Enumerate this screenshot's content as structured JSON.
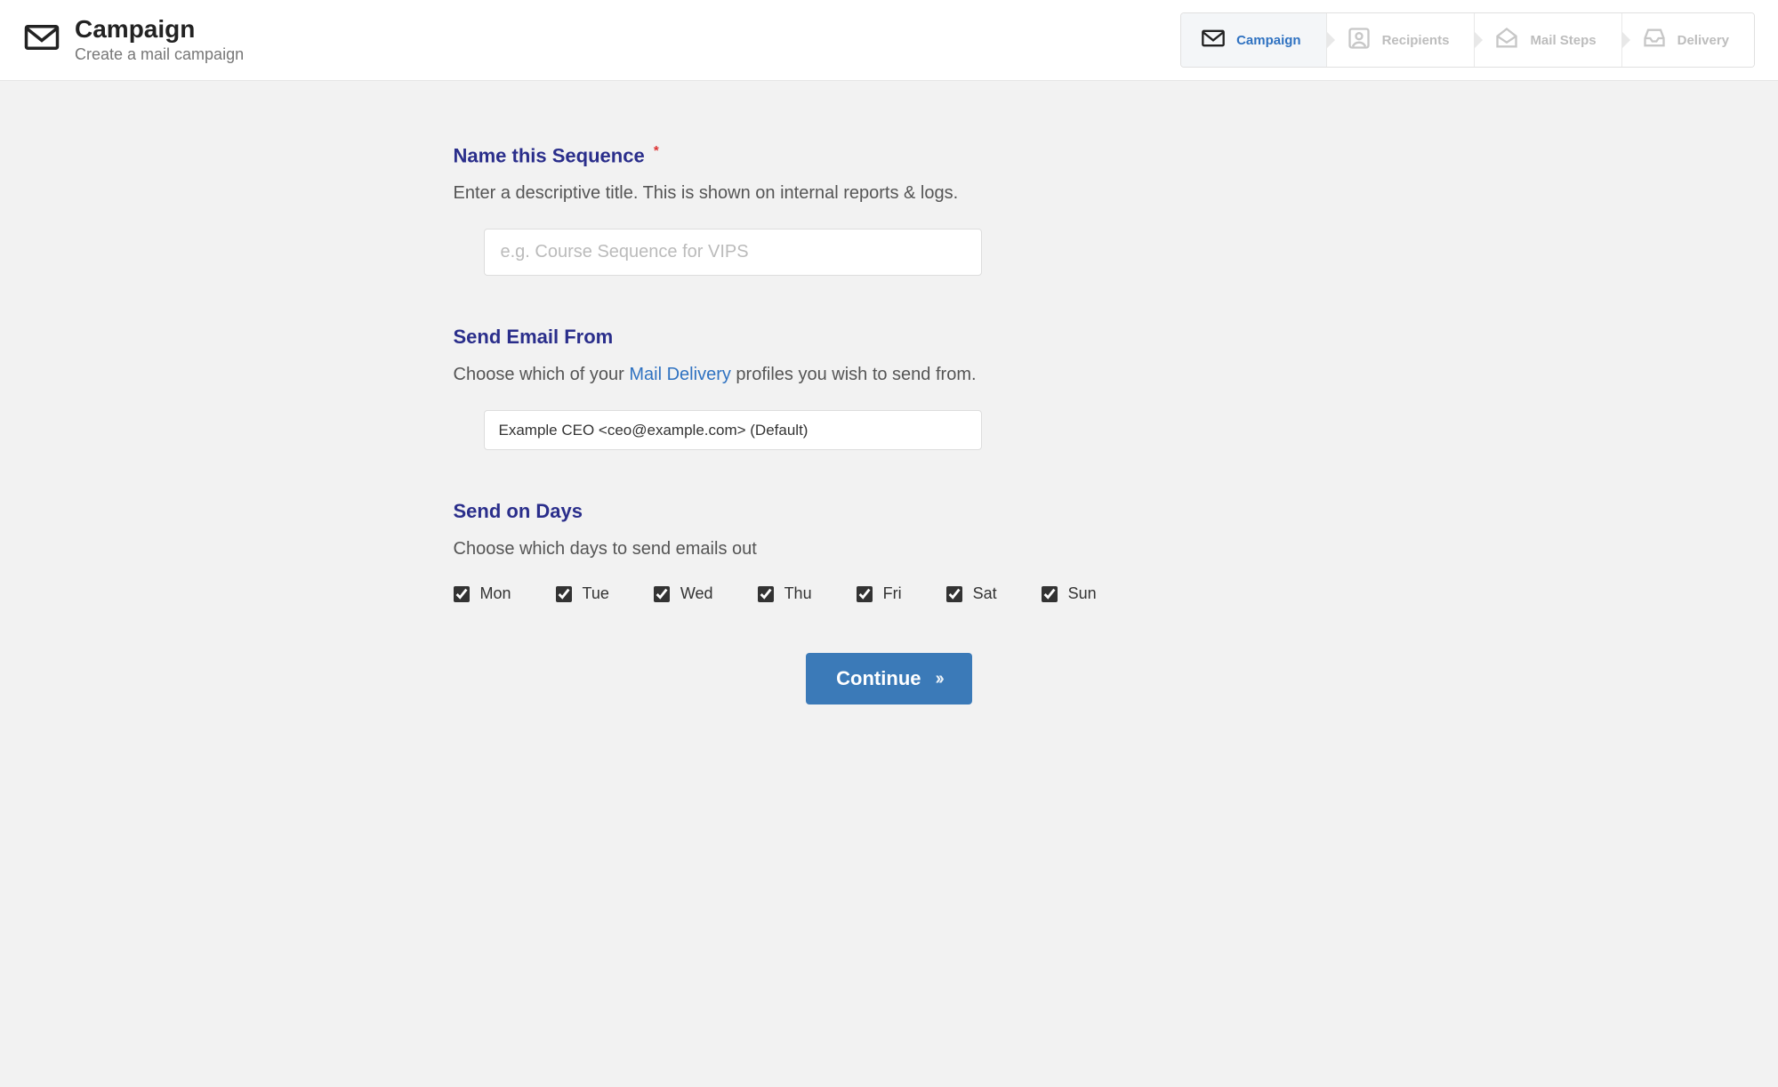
{
  "header": {
    "title": "Campaign",
    "subtitle": "Create a mail campaign"
  },
  "steps": [
    {
      "label": "Campaign",
      "icon": "envelope",
      "active": true
    },
    {
      "label": "Recipients",
      "icon": "user-box",
      "active": false
    },
    {
      "label": "Mail Steps",
      "icon": "open-envelope",
      "active": false
    },
    {
      "label": "Delivery",
      "icon": "inbox",
      "active": false
    }
  ],
  "form": {
    "name": {
      "heading": "Name this Sequence",
      "required": true,
      "description": "Enter a descriptive title. This is shown on internal reports & logs.",
      "placeholder": "e.g. Course Sequence for VIPS",
      "value": ""
    },
    "from": {
      "heading": "Send Email From",
      "description_pre": "Choose which of your ",
      "description_link": "Mail Delivery",
      "description_post": " profiles you wish to send from.",
      "selected": "Example CEO <ceo@example.com> (Default)"
    },
    "days": {
      "heading": "Send on Days",
      "description": "Choose which days to send emails out",
      "options": [
        {
          "label": "Mon",
          "checked": true
        },
        {
          "label": "Tue",
          "checked": true
        },
        {
          "label": "Wed",
          "checked": true
        },
        {
          "label": "Thu",
          "checked": true
        },
        {
          "label": "Fri",
          "checked": true
        },
        {
          "label": "Sat",
          "checked": true
        },
        {
          "label": "Sun",
          "checked": true
        }
      ]
    }
  },
  "actions": {
    "continue": "Continue"
  }
}
